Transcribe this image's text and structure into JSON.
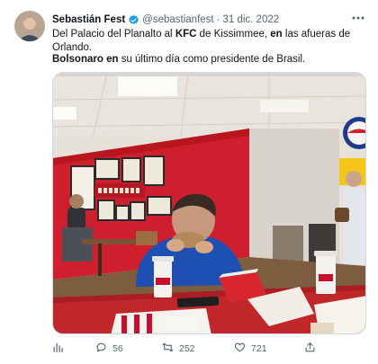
{
  "author": {
    "name": "Sebastián Fest",
    "handle": "@sebastianfest",
    "separator": "·",
    "date": "31 dic. 2022"
  },
  "tweet": {
    "line1_a": "Del Palacio del Planalto al ",
    "line1_kfc": "KFC",
    "line1_b": " de Kissimmee, ",
    "line1_en": "en",
    "line1_c": " las afueras de Orlando.",
    "line2_name": "Bolsonaro",
    "line2_space": " ",
    "line2_en": "en",
    "line2_rest": " su último día como presidente de Brasil."
  },
  "actions": {
    "views_icon": "analytics-icon",
    "replies": "56",
    "retweets": "252",
    "likes": "721",
    "share_icon": "share-icon"
  },
  "colors": {
    "verified": "#1d9bf0",
    "muted": "#536471",
    "kfc_red": "#c8102e"
  }
}
